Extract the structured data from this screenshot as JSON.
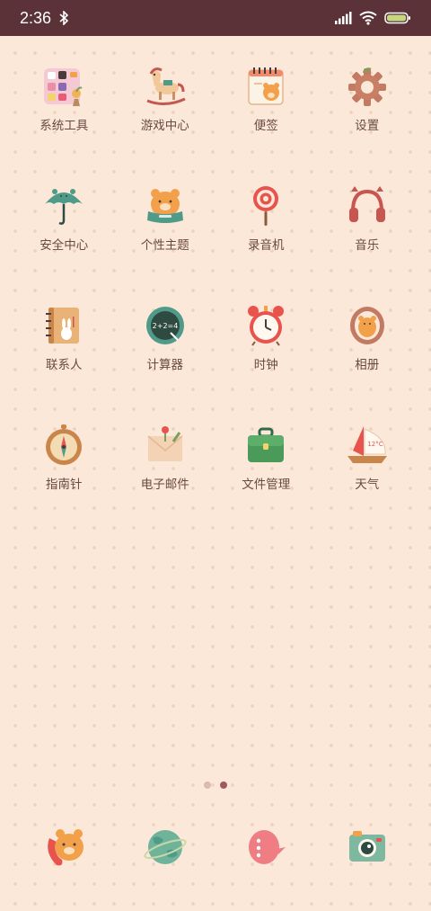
{
  "status_bar": {
    "time": "2:36",
    "icons": [
      "bluetooth-icon",
      "signal-icon",
      "wifi-icon",
      "battery-icon"
    ]
  },
  "apps": [
    {
      "label": "系统工具",
      "icon": "tools-folder-icon"
    },
    {
      "label": "游戏中心",
      "icon": "rocking-horse-icon"
    },
    {
      "label": "便签",
      "icon": "notepad-icon"
    },
    {
      "label": "设置",
      "icon": "gear-icon"
    },
    {
      "label": "安全中心",
      "icon": "umbrella-icon"
    },
    {
      "label": "个性主题",
      "icon": "bear-theme-icon"
    },
    {
      "label": "录音机",
      "icon": "lollipop-mic-icon"
    },
    {
      "label": "音乐",
      "icon": "headphones-icon"
    },
    {
      "label": "联系人",
      "icon": "contacts-book-icon"
    },
    {
      "label": "计算器",
      "icon": "chalkboard-icon"
    },
    {
      "label": "时钟",
      "icon": "alarm-clock-icon"
    },
    {
      "label": "相册",
      "icon": "photo-frame-icon"
    },
    {
      "label": "指南针",
      "icon": "compass-icon"
    },
    {
      "label": "电子邮件",
      "icon": "envelope-icon"
    },
    {
      "label": "文件管理",
      "icon": "briefcase-icon"
    },
    {
      "label": "天气",
      "icon": "sailboat-icon"
    }
  ],
  "weather_icon_text": "12°C",
  "calculator_icon_text": "2+2=4",
  "page_indicator": {
    "pages": 2,
    "current": 2
  },
  "dock": [
    {
      "icon": "bear-phone-icon"
    },
    {
      "icon": "planet-browser-icon"
    },
    {
      "icon": "chat-bubble-icon"
    },
    {
      "icon": "camera-icon"
    }
  ],
  "colors": {
    "status_bar": "#5a3238",
    "background": "#fbe8d8",
    "label": "#6a4a40",
    "active_dot": "#a05a5e",
    "inactive_dot": "#dcbab0"
  }
}
